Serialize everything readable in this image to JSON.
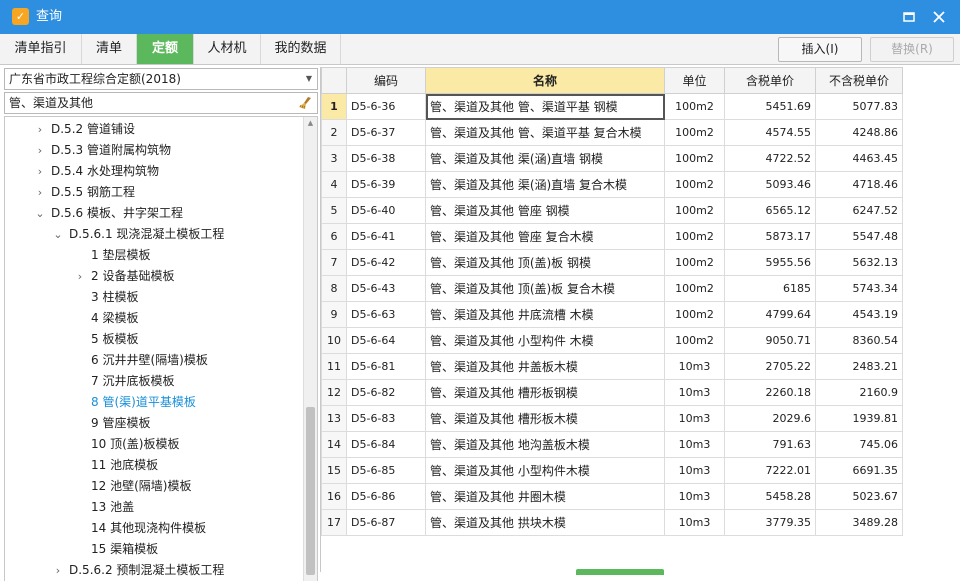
{
  "window": {
    "title": "查询",
    "app_icon": "app-logo",
    "controls": [
      "maximize-icon",
      "close-icon"
    ],
    "accent_color": "#2e8fe0"
  },
  "tabs": [
    "清单指引",
    "清单",
    "定额",
    "人材机",
    "我的数据"
  ],
  "active_tab": "定额",
  "active_tab_color": "#5cb85c",
  "toolbar": {
    "insert_label": "插入(I)",
    "replace_label": "替换(R)"
  },
  "left": {
    "quota_library": "广东省市政工程综合定额(2018)",
    "search_value": "管、渠道及其他",
    "tree": [
      {
        "label": "D.5.2 管道铺设",
        "chevron": "›"
      },
      {
        "label": "D.5.3 管道附属构筑物",
        "chevron": "›"
      },
      {
        "label": "D.5.4 水处理构筑物",
        "chevron": "›"
      },
      {
        "label": "D.5.5 钢筋工程",
        "chevron": "›"
      },
      {
        "label": "D.5.6 模板、井字架工程",
        "chevron": "⌄"
      },
      {
        "label": "D.5.6.1 现浇混凝土模板工程",
        "chevron": "⌄"
      },
      {
        "label": "1 垫层模板",
        "chevron": ""
      },
      {
        "label": "2 设备基础模板",
        "chevron": "›"
      },
      {
        "label": "3 柱模板",
        "chevron": ""
      },
      {
        "label": "4 梁模板",
        "chevron": ""
      },
      {
        "label": "5 板模板",
        "chevron": ""
      },
      {
        "label": "6 沉井井壁(隔墙)模板",
        "chevron": ""
      },
      {
        "label": "7 沉井底板模板",
        "chevron": ""
      },
      {
        "label": "8 管(渠)道平基模板",
        "chevron": "",
        "selected": true
      },
      {
        "label": "9 管座模板",
        "chevron": ""
      },
      {
        "label": "10 顶(盖)板模板",
        "chevron": ""
      },
      {
        "label": "11 池底模板",
        "chevron": ""
      },
      {
        "label": "12 池壁(隔墙)模板",
        "chevron": ""
      },
      {
        "label": "13 池盖",
        "chevron": ""
      },
      {
        "label": "14 其他现浇构件模板",
        "chevron": ""
      },
      {
        "label": "15 渠箱模板",
        "chevron": ""
      },
      {
        "label": "D.5.6.2 预制混凝土模板工程",
        "chevron": "›"
      }
    ]
  },
  "table": {
    "headers": [
      "",
      "编码",
      "名称",
      "单位",
      "含税单价",
      "不含税单价"
    ],
    "rows": [
      {
        "no": "1",
        "code": "D5-6-36",
        "name": "管、渠道及其他 管、渠道平基 钢模",
        "unit": "100m2",
        "price_tax": "5451.69",
        "price_notax": "5077.83"
      },
      {
        "no": "2",
        "code": "D5-6-37",
        "name": "管、渠道及其他 管、渠道平基 复合木模",
        "unit": "100m2",
        "price_tax": "4574.55",
        "price_notax": "4248.86"
      },
      {
        "no": "3",
        "code": "D5-6-38",
        "name": "管、渠道及其他 渠(涵)直墙 钢模",
        "unit": "100m2",
        "price_tax": "4722.52",
        "price_notax": "4463.45"
      },
      {
        "no": "4",
        "code": "D5-6-39",
        "name": "管、渠道及其他 渠(涵)直墙 复合木模",
        "unit": "100m2",
        "price_tax": "5093.46",
        "price_notax": "4718.46"
      },
      {
        "no": "5",
        "code": "D5-6-40",
        "name": "管、渠道及其他 管座 钢模",
        "unit": "100m2",
        "price_tax": "6565.12",
        "price_notax": "6247.52"
      },
      {
        "no": "6",
        "code": "D5-6-41",
        "name": "管、渠道及其他 管座 复合木模",
        "unit": "100m2",
        "price_tax": "5873.17",
        "price_notax": "5547.48"
      },
      {
        "no": "7",
        "code": "D5-6-42",
        "name": "管、渠道及其他 顶(盖)板 钢模",
        "unit": "100m2",
        "price_tax": "5955.56",
        "price_notax": "5632.13"
      },
      {
        "no": "8",
        "code": "D5-6-43",
        "name": "管、渠道及其他 顶(盖)板 复合木模",
        "unit": "100m2",
        "price_tax": "6185",
        "price_notax": "5743.34"
      },
      {
        "no": "9",
        "code": "D5-6-63",
        "name": "管、渠道及其他 井底流槽 木模",
        "unit": "100m2",
        "price_tax": "4799.64",
        "price_notax": "4543.19"
      },
      {
        "no": "10",
        "code": "D5-6-64",
        "name": "管、渠道及其他 小型构件 木模",
        "unit": "100m2",
        "price_tax": "9050.71",
        "price_notax": "8360.54"
      },
      {
        "no": "11",
        "code": "D5-6-81",
        "name": "管、渠道及其他 井盖板木模",
        "unit": "10m3",
        "price_tax": "2705.22",
        "price_notax": "2483.21"
      },
      {
        "no": "12",
        "code": "D5-6-82",
        "name": "管、渠道及其他 槽形板钢模",
        "unit": "10m3",
        "price_tax": "2260.18",
        "price_notax": "2160.9"
      },
      {
        "no": "13",
        "code": "D5-6-83",
        "name": "管、渠道及其他 槽形板木模",
        "unit": "10m3",
        "price_tax": "2029.6",
        "price_notax": "1939.81"
      },
      {
        "no": "14",
        "code": "D5-6-84",
        "name": "管、渠道及其他 地沟盖板木模",
        "unit": "10m3",
        "price_tax": "791.63",
        "price_notax": "745.06"
      },
      {
        "no": "15",
        "code": "D5-6-85",
        "name": "管、渠道及其他 小型构件木模",
        "unit": "10m3",
        "price_tax": "7222.01",
        "price_notax": "6691.35"
      },
      {
        "no": "16",
        "code": "D5-6-86",
        "name": "管、渠道及其他 井圈木模",
        "unit": "10m3",
        "price_tax": "5458.28",
        "price_notax": "5023.67"
      },
      {
        "no": "17",
        "code": "D5-6-87",
        "name": "管、渠道及其他 拱块木模",
        "unit": "10m3",
        "price_tax": "3779.35",
        "price_notax": "3489.28"
      }
    ],
    "selected_row": "1"
  }
}
